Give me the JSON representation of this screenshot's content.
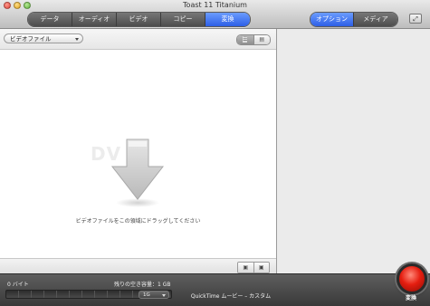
{
  "window": {
    "title": "Toast 11 Titanium"
  },
  "tabs": [
    {
      "label": "データ",
      "active": false
    },
    {
      "label": "オーディオ",
      "active": false
    },
    {
      "label": "ビデオ",
      "active": false
    },
    {
      "label": "コピー",
      "active": false
    },
    {
      "label": "変換",
      "active": true
    }
  ],
  "right_tabs": [
    {
      "label": "オプション",
      "active": true
    },
    {
      "label": "メディア",
      "active": false
    }
  ],
  "left_panel": {
    "dropdown_value": "ビデオファイル",
    "view_modes": [
      "list-icon",
      "grid-icon"
    ],
    "watermark": "DV",
    "drop_hint": "ビデオファイルをこの領域にドラッグしてください",
    "accent_colors": {
      "tab_active": "#2d5fe6",
      "convert_button": "#e51e10"
    }
  },
  "bottom": {
    "size_used": "0 バイト",
    "free_space": "残りの空き容量：1 GB",
    "disc_size": "1G",
    "format": "QuickTime ムービー – カスタム",
    "convert_label": "変換"
  }
}
